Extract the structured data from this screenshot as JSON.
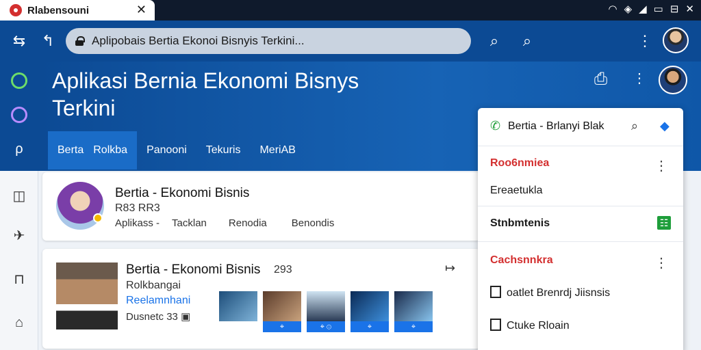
{
  "browser": {
    "tab_title": "Rlabensouni",
    "tab_close": "✕",
    "url": "Aplipobais Bertia Ekonoi Bisnyis Terkini...",
    "system_icons": [
      "wifi-icon",
      "shield-icon",
      "signal-icon",
      "battery-icon",
      "window-icon",
      "close-icon"
    ]
  },
  "header": {
    "title": "Aplikasi Bernia Ekonomi Bisnys Terkini",
    "tabs": [
      {
        "label": "Berta"
      },
      {
        "label": "Rolkba"
      },
      {
        "label": "Panooni"
      },
      {
        "label": "Tekuris"
      },
      {
        "label": "MeriAB"
      }
    ]
  },
  "card1": {
    "title": "Bertia - Ekonomi Bisnis",
    "subtitle": "R83 RR3",
    "meta": [
      "Aplikass -",
      "Tacklan",
      "Renodia",
      "Benondis"
    ]
  },
  "card2": {
    "title": "Bertia - Ekonomi Bisnis",
    "number": "293",
    "arrow": "↦",
    "subtitle": "Rolkbangai",
    "link": "Reelamnhani",
    "meta": "Dusnetc 33"
  },
  "panel": {
    "header": "Bertia - Brlanyi Blak",
    "rows": [
      {
        "title": "Roo6nmiea",
        "text": "Ereaetukla"
      },
      {
        "title": "Stnbmtenis"
      },
      {
        "title": "Cachsnnkra",
        "items": [
          "oatlet Brenrdj Jiisnsis",
          "Ctuke Rloain"
        ]
      }
    ]
  },
  "colors": {
    "accent": "#0c4a94",
    "link": "#1a73e8",
    "alert": "#d32f2f",
    "success": "#1e9e3a"
  }
}
